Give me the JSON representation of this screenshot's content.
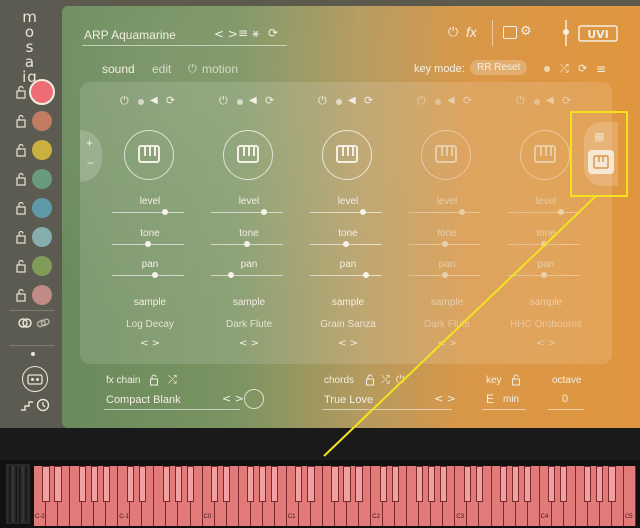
{
  "app": {
    "logo_lines": [
      "m",
      "o",
      "s",
      "a",
      "iq"
    ]
  },
  "sidebar": {
    "slots": [
      {
        "color": "#ec6e74",
        "selected": true
      },
      {
        "color": "#c27c62"
      },
      {
        "color": "#c9b040"
      },
      {
        "color": "#6a9a7c"
      },
      {
        "color": "#5f9aa8"
      },
      {
        "color": "#86aeae"
      },
      {
        "color": "#7f9c58"
      },
      {
        "color": "#c08a86"
      }
    ]
  },
  "header": {
    "preset_name": "ARP Aquamarine",
    "tabs": [
      "sound",
      "edit",
      "motion"
    ],
    "active_tab": "sound",
    "key_mode_label": "key mode:",
    "key_mode_value": "RR Reset",
    "brand": "UVI"
  },
  "layers": [
    {
      "level": 0.75,
      "tone": 0.5,
      "pan": 0.6,
      "sample": "Log Decay",
      "active": true
    },
    {
      "level": 0.75,
      "tone": 0.5,
      "pan": 0.25,
      "sample": "Dark Flute",
      "active": true
    },
    {
      "level": 0.75,
      "tone": 0.5,
      "pan": 0.8,
      "sample": "Grain Sanza",
      "active": true
    },
    {
      "level": 0.75,
      "tone": 0.5,
      "pan": 0.5,
      "sample": "Dark Flute",
      "active": false
    },
    {
      "level": 0.75,
      "tone": 0.5,
      "pan": 0.5,
      "sample": "HHC Orobouros",
      "active": false
    }
  ],
  "labels": {
    "level": "level",
    "tone": "tone",
    "pan": "pan",
    "sample": "sample"
  },
  "footer": {
    "fx_chain_label": "fx chain",
    "fx_chain_value": "Compact Blank",
    "chords_label": "chords",
    "chords_value": "True Love",
    "key_label": "key",
    "key_value": "E",
    "key_scale": "min",
    "octave_label": "octave",
    "octave_value": "0"
  },
  "keyboard": {
    "octave_labels": [
      "C-2",
      "C-1",
      "C0",
      "C1",
      "C2",
      "C3",
      "C4",
      "C5"
    ]
  }
}
